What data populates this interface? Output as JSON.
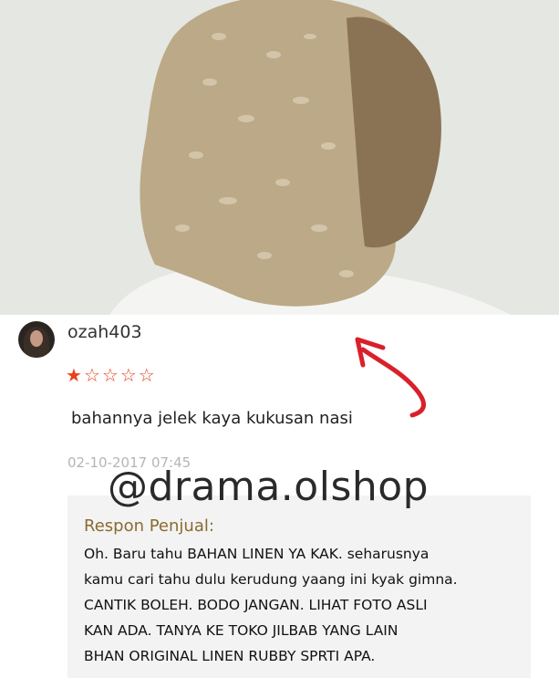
{
  "review": {
    "username": "ozah403",
    "rating": 1,
    "rating_max": 5,
    "star_filled": "★",
    "star_empty": "☆",
    "text": "bahannya jelek kaya kukusan nasi",
    "timestamp": "02-10-2017 07:45"
  },
  "watermark": "@drama.olshop",
  "seller_response": {
    "title": "Respon Penjual:",
    "lines": [
      "Oh. Baru tahu BAHAN LINEN YA KAK. seharusnya",
      "kamu cari tahu dulu kerudung yaang ini kyak gimna.",
      "CANTIK BOLEH. BODO JANGAN. LIHAT FOTO ASLI",
      "KAN ADA. TANYA KE TOKO JILBAB YANG LAIN",
      "BHAN ORIGINAL LINEN RUBBY SPRTI APA."
    ]
  },
  "colors": {
    "star": "#e8431a",
    "arrow": "#d9202a",
    "response_title": "#8a6b2f",
    "hijab": "#bca987"
  }
}
